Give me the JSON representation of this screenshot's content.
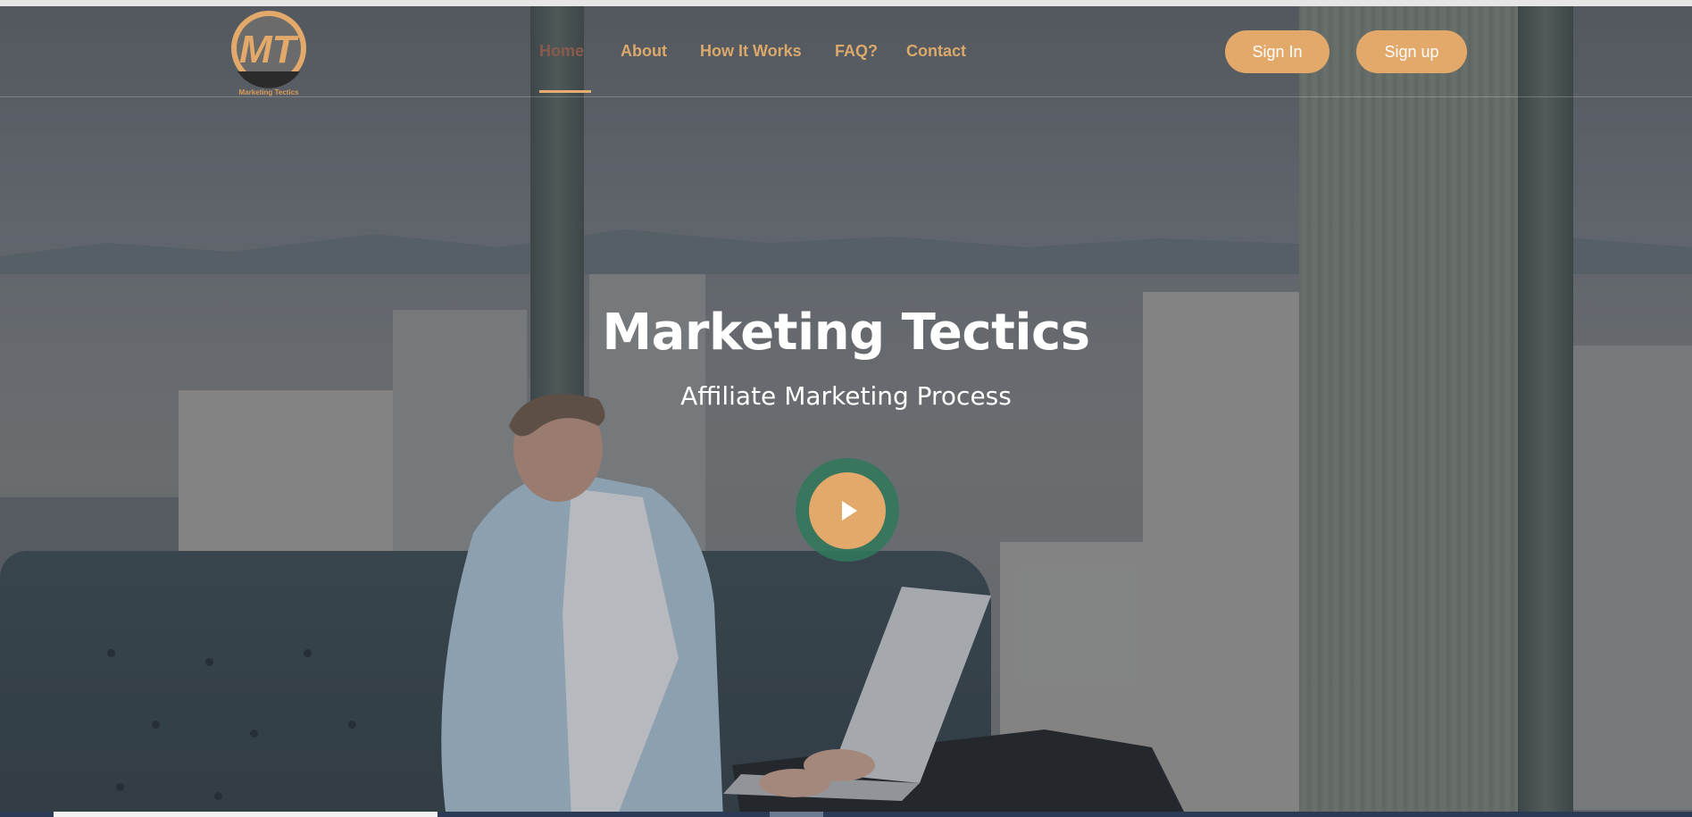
{
  "brand": {
    "logo_letters": "MT",
    "logo_caption": "Marketing Tectics"
  },
  "nav": {
    "items": [
      {
        "label": "Home",
        "active": true
      },
      {
        "label": "About"
      },
      {
        "label": "How It Works"
      },
      {
        "label": "FAQ?"
      },
      {
        "label": "Contact"
      }
    ],
    "sign_in": "Sign In",
    "sign_up": "Sign up"
  },
  "hero": {
    "title": "Marketing Tectics",
    "subtitle": "Affiliate Marketing Process",
    "play_icon": "play-icon"
  },
  "colors": {
    "accent": "#e3a96a",
    "nav_text": "#dba86b",
    "nav_active": "#8b5a4e",
    "play_ring": "#30785c"
  }
}
